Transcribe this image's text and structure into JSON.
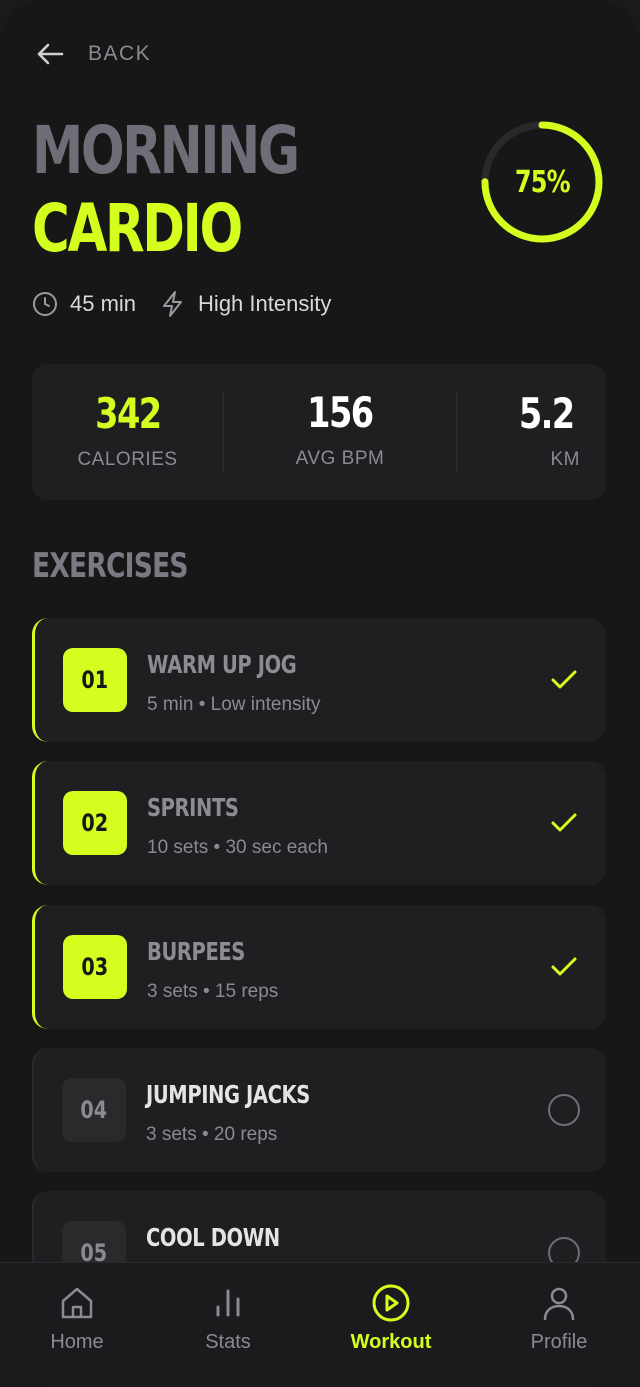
{
  "header": {
    "back_label": "BACK"
  },
  "workout": {
    "title_line1": "MORNING",
    "title_line2": "CARDIO",
    "progress_percent": 75,
    "progress_label": "75%",
    "duration": "45 min",
    "intensity": "High Intensity"
  },
  "stats": [
    {
      "value": "342",
      "label": "CALORIES"
    },
    {
      "value": "156",
      "label": "AVG BPM"
    },
    {
      "value": "5.2",
      "label": "KM"
    }
  ],
  "exercises_title": "EXERCISES",
  "exercises": [
    {
      "number": "01",
      "name": "WARM UP JOG",
      "detail": "5 min • Low intensity",
      "completed": true
    },
    {
      "number": "02",
      "name": "SPRINTS",
      "detail": "10 sets • 30 sec each",
      "completed": true
    },
    {
      "number": "03",
      "name": "BURPEES",
      "detail": "3 sets • 15 reps",
      "completed": true
    },
    {
      "number": "04",
      "name": "JUMPING JACKS",
      "detail": "3 sets • 20 reps",
      "completed": false
    },
    {
      "number": "05",
      "name": "COOL DOWN",
      "detail": "",
      "completed": false
    }
  ],
  "nav": {
    "items": [
      {
        "label": "Home",
        "icon": "home-icon",
        "active": false
      },
      {
        "label": "Stats",
        "icon": "stats-icon",
        "active": false
      },
      {
        "label": "Workout",
        "icon": "play-circle-icon",
        "active": true
      },
      {
        "label": "Profile",
        "icon": "user-icon",
        "active": false
      }
    ]
  },
  "colors": {
    "accent": "#d4ff1e",
    "background": "#171717",
    "card": "#1f1f21",
    "muted": "#8a8a93"
  }
}
